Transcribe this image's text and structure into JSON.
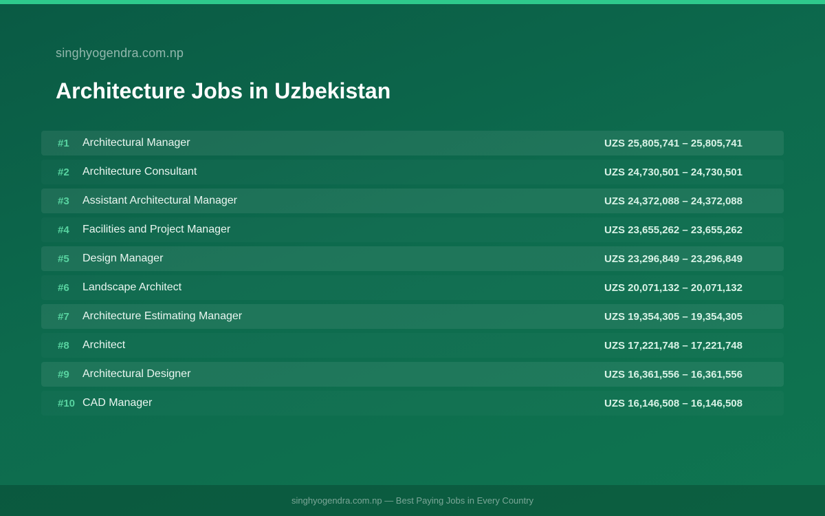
{
  "header": {
    "site_name": "singhyogendra.com.np",
    "title": "Architecture Jobs in Uzbekistan"
  },
  "jobs": [
    {
      "rank": "#1",
      "title": "Architectural Manager",
      "salary": "UZS 25,805,741 – 25,805,741"
    },
    {
      "rank": "#2",
      "title": "Architecture Consultant",
      "salary": "UZS 24,730,501 – 24,730,501"
    },
    {
      "rank": "#3",
      "title": "Assistant Architectural Manager",
      "salary": "UZS 24,372,088 – 24,372,088"
    },
    {
      "rank": "#4",
      "title": "Facilities and Project Manager",
      "salary": "UZS 23,655,262 – 23,655,262"
    },
    {
      "rank": "#5",
      "title": "Design Manager",
      "salary": "UZS 23,296,849 – 23,296,849"
    },
    {
      "rank": "#6",
      "title": "Landscape Architect",
      "salary": "UZS 20,071,132 – 20,071,132"
    },
    {
      "rank": "#7",
      "title": "Architecture Estimating Manager",
      "salary": "UZS 19,354,305 – 19,354,305"
    },
    {
      "rank": "#8",
      "title": "Architect",
      "salary": "UZS 17,221,748 – 17,221,748"
    },
    {
      "rank": "#9",
      "title": "Architectural Designer",
      "salary": "UZS 16,361,556 – 16,361,556"
    },
    {
      "rank": "#10",
      "title": "CAD Manager",
      "salary": "UZS 16,146,508 – 16,146,508"
    }
  ],
  "footer": {
    "text": "singhyogendra.com.np — Best Paying Jobs in Every Country"
  },
  "colors": {
    "accent": "#2ec98c",
    "rank": "#58d3a0",
    "background": "#0d6a4d"
  }
}
